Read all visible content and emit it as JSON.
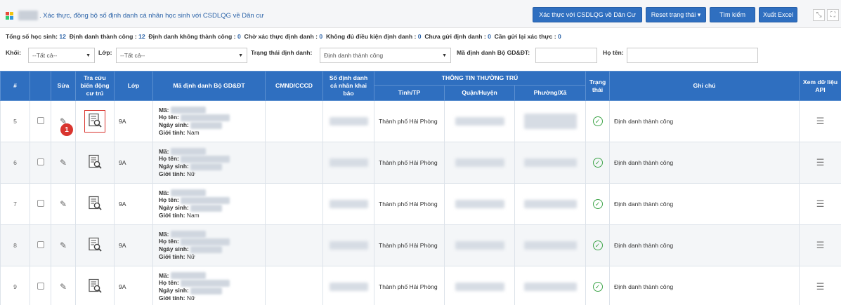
{
  "header": {
    "title": ". Xác thực, đồng bộ số định danh cá nhân học sinh với CSDLQG về Dân cư",
    "buttons": {
      "verify": "Xác thực với CSDLQG về Dân Cư",
      "reset": "Reset trạng thái",
      "search": "Tìm kiếm",
      "export": "Xuất Excel"
    },
    "colors": {
      "primary": "#2f6fc0",
      "success": "#3fa54a",
      "marker": "#d9352f"
    }
  },
  "summary": {
    "total_label": "Tổng số học sinh:",
    "total": "12",
    "success_label": "Định danh thành công :",
    "success": "12",
    "fail_label": "Định danh không thành công :",
    "fail": "0",
    "pending_label": "Chờ xác thực định danh :",
    "pending": "0",
    "insufficient_label": "Không đủ điều kiện định danh :",
    "insufficient": "0",
    "unsent_label": "Chưa gửi định danh :",
    "unsent": "0",
    "resend_label": "Cần gửi lại xác thực :",
    "resend": "0"
  },
  "filters": {
    "khoi_label": "Khối:",
    "khoi_value": "--Tất cả--",
    "lop_label": "Lớp:",
    "lop_value": "--Tất cả--",
    "trang_thai_label": "Trạng thái định danh:",
    "trang_thai_value": "Định danh thành công",
    "ma_label": "Mã định danh Bộ GD&ĐT:",
    "ma_value": "",
    "ho_ten_label": "Họ tên:",
    "ho_ten_value": ""
  },
  "table": {
    "headers": {
      "stt": "#",
      "sua": "Sửa",
      "tra_cuu_1": "Tra cứu",
      "tra_cuu_2": "biến động",
      "tra_cuu_3": "cư trú",
      "lop": "Lớp",
      "ma_dinh_danh": "Mã định danh Bộ GD&ĐT",
      "cmnd": "CMND/CCCD",
      "so_dinh_danh_1": "Số định danh",
      "so_dinh_danh_2": "cá nhân khai",
      "so_dinh_danh_3": "báo",
      "thuong_tru": "THÔNG TIN THƯỜNG TRÚ",
      "tinh": "Tỉnh/TP",
      "quan": "Quận/Huyện",
      "phuong": "Phường/Xã",
      "trang_thai_1": "Trạng",
      "trang_thai_2": "thái",
      "ghi_chu": "Ghi chú",
      "api_1": "Xem dữ liệu",
      "api_2": "API"
    },
    "field_labels": {
      "ma": "Mã:",
      "ho_ten": "Họ tên:",
      "ngay_sinh": "Ngày sinh:",
      "gioi_tinh": "Giới tính:"
    },
    "rows": [
      {
        "stt": "5",
        "lop": "9A",
        "gioi_tinh": "Nam",
        "tinh": "Thành phố Hải Phòng",
        "ghi_chu": "Định danh thành công"
      },
      {
        "stt": "6",
        "lop": "9A",
        "gioi_tinh": "Nữ",
        "tinh": "Thành phố Hải Phòng",
        "ghi_chu": "Định danh thành công"
      },
      {
        "stt": "7",
        "lop": "9A",
        "gioi_tinh": "Nam",
        "tinh": "Thành phố Hải Phòng",
        "ghi_chu": "Định danh thành công"
      },
      {
        "stt": "8",
        "lop": "9A",
        "gioi_tinh": "Nữ",
        "tinh": "Thành phố Hải Phòng",
        "ghi_chu": "Định danh thành công"
      },
      {
        "stt": "9",
        "lop": "9A",
        "gioi_tinh": "Nữ",
        "tinh": "Thành phố Hải Phòng",
        "ghi_chu": "Định danh thành công"
      }
    ]
  },
  "annotation": {
    "marker": "1"
  }
}
